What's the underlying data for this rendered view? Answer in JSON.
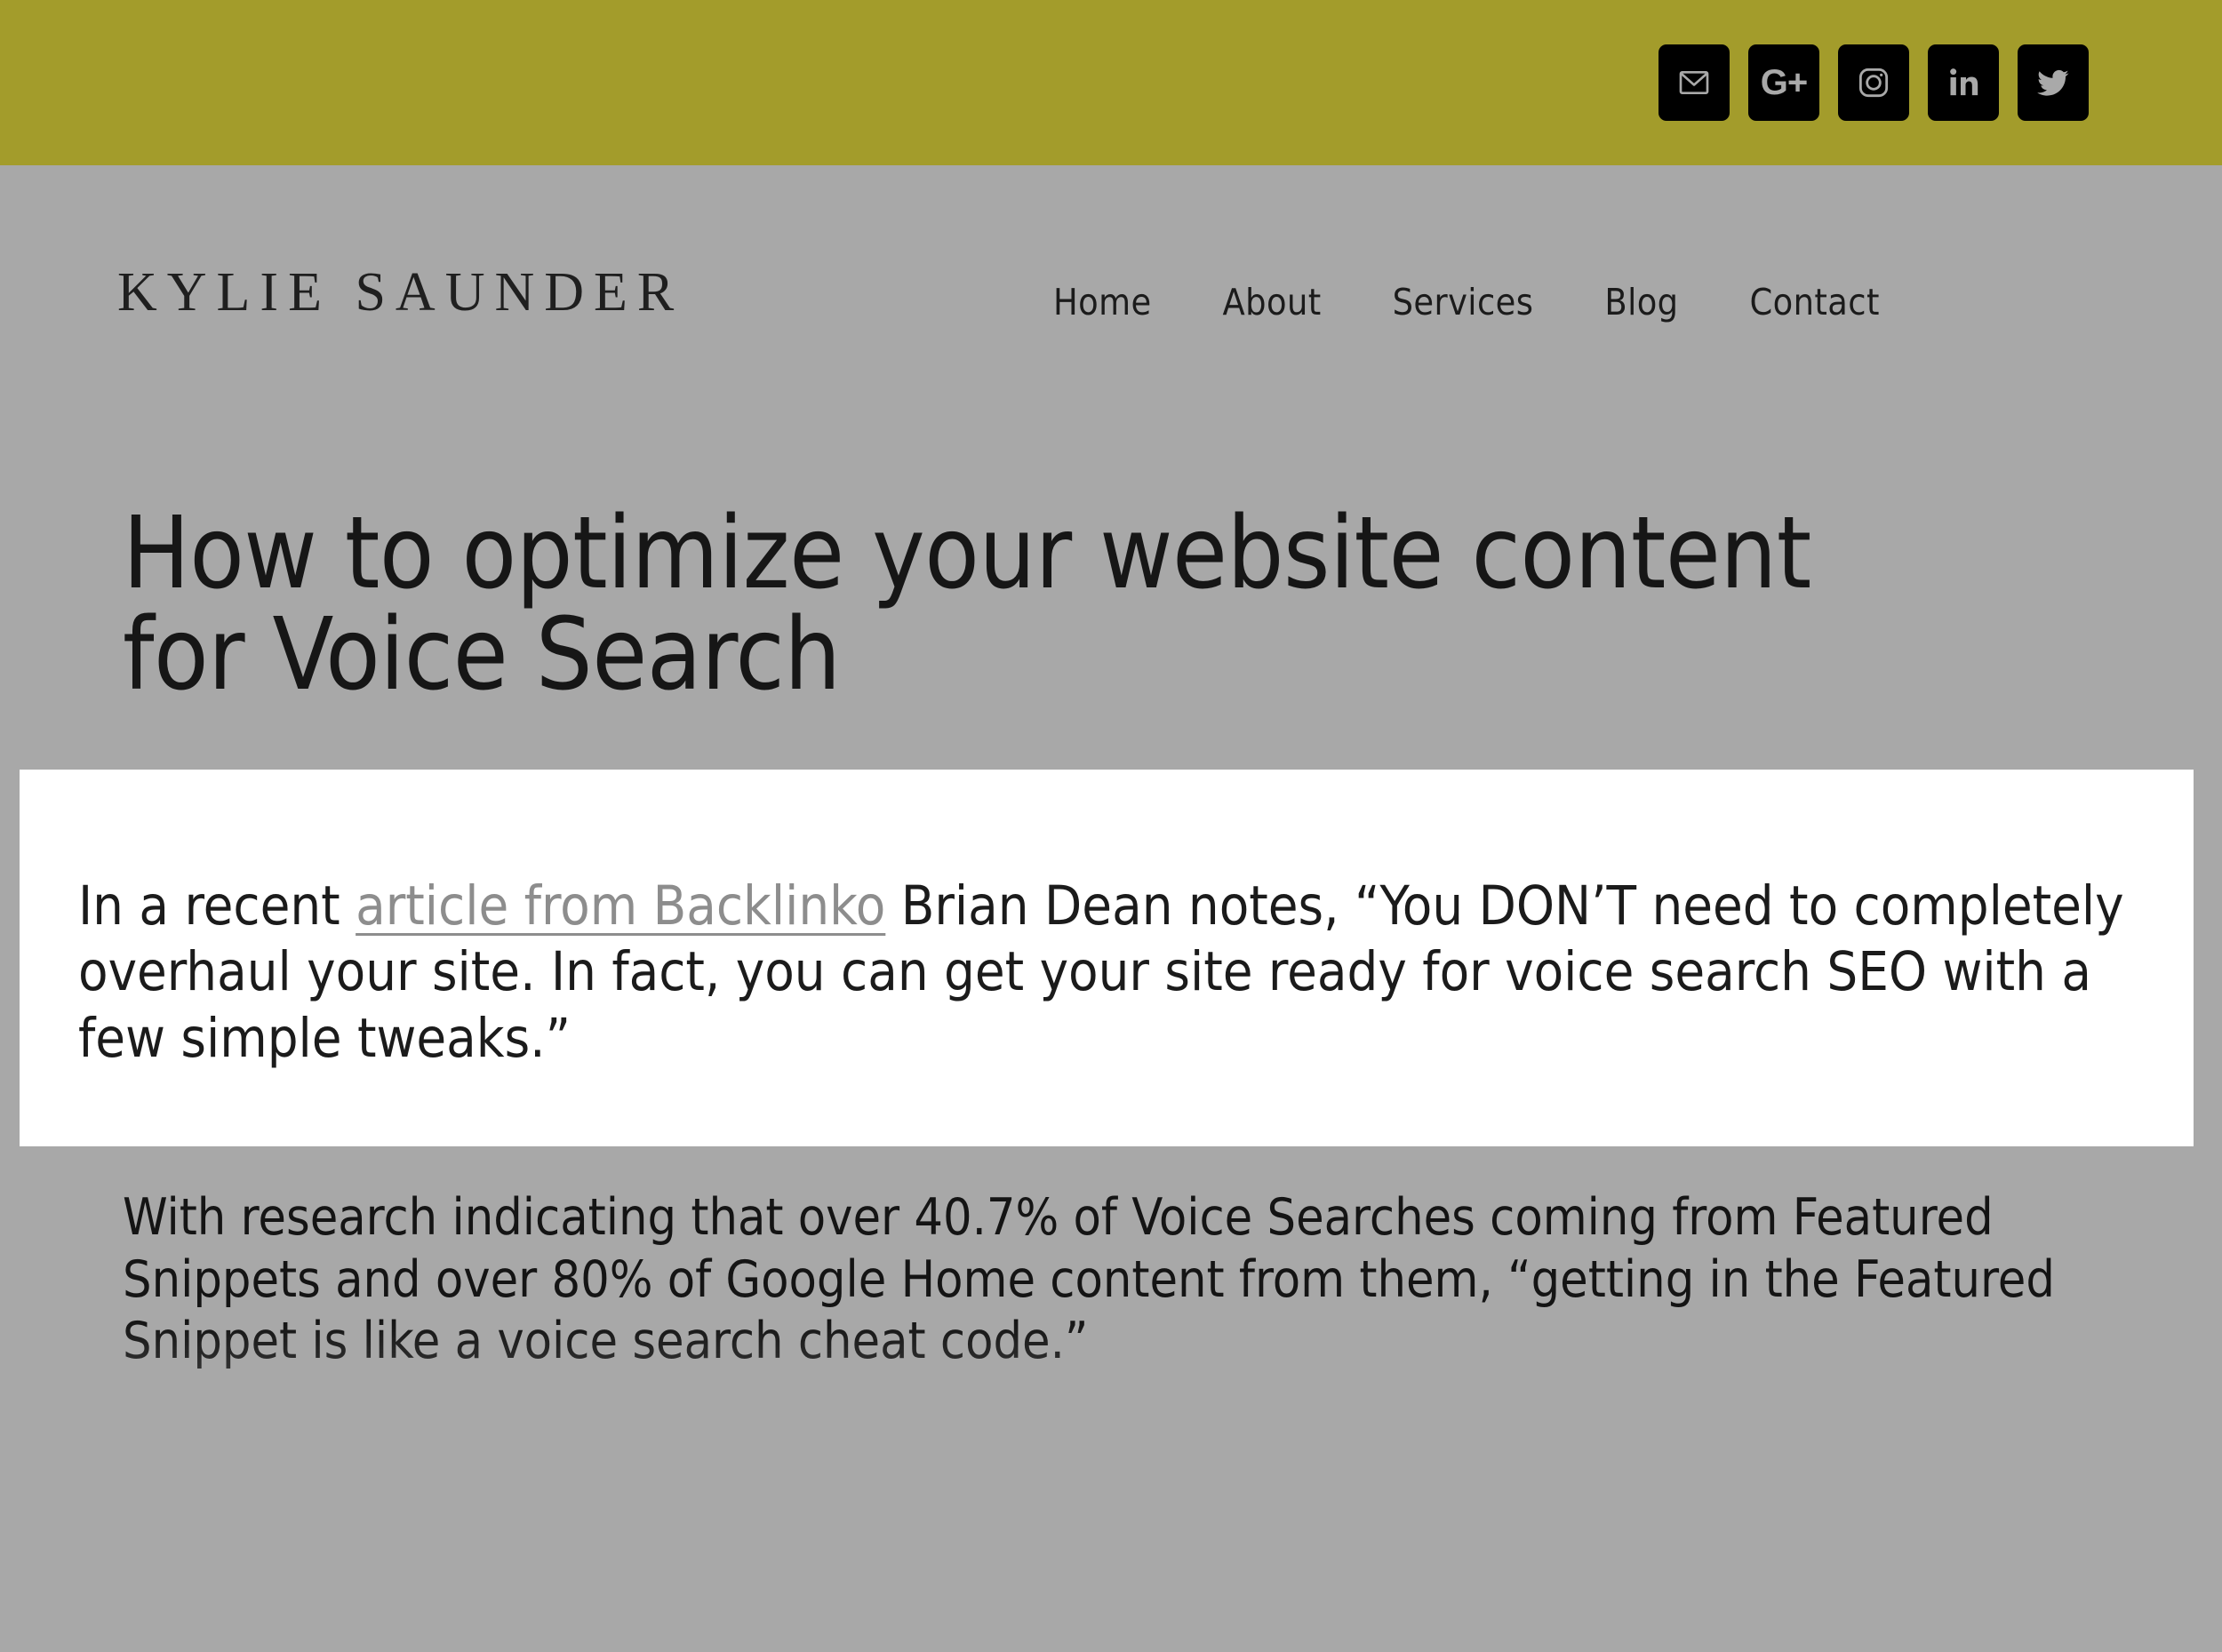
{
  "colors": {
    "accent_bar": "#a39c2b",
    "page_background": "#a8a8a8",
    "highlight_background": "#ffffff",
    "social_button": "#000000",
    "social_icon": "#a9a9a9",
    "body_text": "#141414",
    "link": "#8d8d8d"
  },
  "social_bar": {
    "items": [
      {
        "name": "email",
        "icon": "envelope-icon",
        "label": "Email"
      },
      {
        "name": "google-plus",
        "icon": "google-plus-icon",
        "label": "G+"
      },
      {
        "name": "instagram",
        "icon": "instagram-icon",
        "label": "Instagram"
      },
      {
        "name": "linkedin",
        "icon": "linkedin-icon",
        "label": "in"
      },
      {
        "name": "twitter",
        "icon": "twitter-icon",
        "label": "Twitter"
      }
    ]
  },
  "header": {
    "brand": "KYLIE SAUNDER",
    "nav": [
      {
        "label": "Home"
      },
      {
        "label": "About"
      },
      {
        "label": "Services"
      },
      {
        "label": "Blog"
      },
      {
        "label": "Contact"
      }
    ]
  },
  "article": {
    "title": "How to optimize your website content for Voice Search",
    "highlight": {
      "lead": "In a recent ",
      "link_text": "article from Backlinko",
      "rest": " Brian Dean notes, “You DON’T need to completely overhaul your site. In fact, you can get your site ready for voice search SEO with a few simple tweaks.”"
    },
    "paragraph": "With research indicating that over 40.7% of Voice Searches coming from Featured Snippets and over 80% of Google Home content from them, “getting in the Featured Snippet is like a voice search cheat code.”"
  }
}
